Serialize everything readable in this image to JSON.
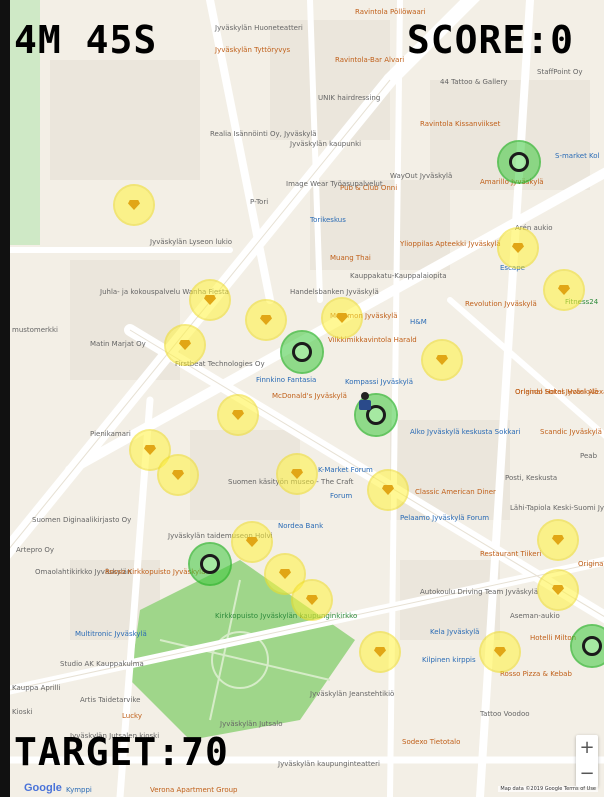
{
  "hud": {
    "timer": "4M 45S",
    "score": "SCORE:0",
    "target": "TARGET:70"
  },
  "map": {
    "attribution": "Map data ©2019 Google   Terms of Use",
    "google_badge": "Google",
    "zoom_in": "+",
    "zoom_out": "−",
    "place_labels": [
      {
        "text": "Jyväskylän Huoneteatteri",
        "style": "grey"
      },
      {
        "text": "Jyväskylän Tyttöryvys",
        "style": "orange"
      },
      {
        "text": "Ravintola Pöllöwaari",
        "style": "orange"
      },
      {
        "text": "Ravintola-Bar Alvari",
        "style": "orange"
      },
      {
        "text": "44 Tattoo & Gallery",
        "style": "grey"
      },
      {
        "text": "StaffPoint Oy",
        "style": "grey"
      },
      {
        "text": "UNIK hairdressing",
        "style": "grey"
      },
      {
        "text": "Ravintola Kissanviikset",
        "style": "orange"
      },
      {
        "text": "Jyväskylän kaupunki",
        "style": "grey"
      },
      {
        "text": "Realia Isännöinti Oy, Jyväskylä",
        "style": "grey"
      },
      {
        "text": "S-market Kol",
        "style": "blue"
      },
      {
        "text": "WayOut Jyväskylä",
        "style": "grey"
      },
      {
        "text": "Amarillo Jyväskylä",
        "style": "orange"
      },
      {
        "text": "Pub & Club Onni",
        "style": "orange"
      },
      {
        "text": "Image Wear Työasupalvelut",
        "style": "grey"
      },
      {
        "text": "P-Tori",
        "style": "grey"
      },
      {
        "text": "Torikeskus",
        "style": "blue"
      },
      {
        "text": "Arén aukio",
        "style": "grey"
      },
      {
        "text": "Ylioppilas Apteekki Jyväskylä",
        "style": "orange"
      },
      {
        "text": "Jyväskylän Lyseon lukio",
        "style": "grey"
      },
      {
        "text": "Muang Thai",
        "style": "orange"
      },
      {
        "text": "Escape",
        "style": "blue"
      },
      {
        "text": "Kauppakatu-Kauppalaiopita",
        "style": "grey"
      },
      {
        "text": "Handelsbanken Jyväskylä",
        "style": "grey"
      },
      {
        "text": "Fitness24",
        "style": "green"
      },
      {
        "text": "Juhla- ja kokouspalvelu Wanha Fiesta",
        "style": "grey"
      },
      {
        "text": "H&M",
        "style": "blue"
      },
      {
        "text": "Revolution Jyväskylä",
        "style": "orange"
      },
      {
        "text": "Mummon Jyväskylä",
        "style": "orange"
      },
      {
        "text": "Vilkkimikkavintola Harald",
        "style": "orange"
      },
      {
        "text": "mustomerkki",
        "style": "grey"
      },
      {
        "text": "Matin Marjat Oy",
        "style": "grey"
      },
      {
        "text": "Firstbeat Technologies Oy",
        "style": "grey"
      },
      {
        "text": "Finnkino Fantasia",
        "style": "blue"
      },
      {
        "text": "Kompassi Jyväskylä",
        "style": "blue"
      },
      {
        "text": "McDonald's Jyväskylä",
        "style": "orange"
      },
      {
        "text": "Original Sokos Hotel Alexandra",
        "style": "orange"
      },
      {
        "text": "Pienikamari",
        "style": "grey"
      },
      {
        "text": "Alko Jyväskylä keskusta Sokkari",
        "style": "blue"
      },
      {
        "text": "Scandic Jyväskylä",
        "style": "orange"
      },
      {
        "text": "K-Market Forum",
        "style": "blue"
      },
      {
        "text": "Posti, Keskusta",
        "style": "grey"
      },
      {
        "text": "Suomen käsityön museo - The Craft",
        "style": "grey"
      },
      {
        "text": "Forum",
        "style": "blue"
      },
      {
        "text": "Classic American Diner",
        "style": "orange"
      },
      {
        "text": "Lähi-Tapiola Keski-Suomi Jyväskylä",
        "style": "grey"
      },
      {
        "text": "Suomen Diginaalikirjasto Oy",
        "style": "grey"
      },
      {
        "text": "Nordea Bank",
        "style": "blue"
      },
      {
        "text": "Pelaamo Jyväskylä Forum",
        "style": "blue"
      },
      {
        "text": "Jyväskylän taidemuseon Holvi",
        "style": "grey"
      },
      {
        "text": "Restaurant Tiikeri",
        "style": "orange"
      },
      {
        "text": "Artepro Oy",
        "style": "grey"
      },
      {
        "text": "Omaolahtikirkko Jyväskylän",
        "style": "grey"
      },
      {
        "text": "Rosso Kirkkopuisto Jyväskylä",
        "style": "orange"
      },
      {
        "text": "Autokoulu Driving Team Jyväskylä",
        "style": "grey"
      },
      {
        "text": "Aseman-aukio",
        "style": "grey"
      },
      {
        "text": "Kirkkopuisto Jyväskylän kaupunginkirkko",
        "style": "green"
      },
      {
        "text": "Multitronic Jyväskylä",
        "style": "blue"
      },
      {
        "text": "Kela Jyväskylä",
        "style": "blue"
      },
      {
        "text": "Hotelli Milton",
        "style": "orange"
      },
      {
        "text": "Studio AK Kauppakulma",
        "style": "grey"
      },
      {
        "text": "Kilpinen kirppis",
        "style": "blue"
      },
      {
        "text": "Rosso Pizza & Kebab",
        "style": "orange"
      },
      {
        "text": "Kauppa Aprilli",
        "style": "grey"
      },
      {
        "text": "Artis Taidetarvike",
        "style": "grey"
      },
      {
        "text": "Jyväskylän Jeanstehtikiö",
        "style": "grey"
      },
      {
        "text": "Lucky",
        "style": "orange"
      },
      {
        "text": "Tattoo Voodoo",
        "style": "grey"
      },
      {
        "text": "Kioski",
        "style": "grey"
      },
      {
        "text": "Jyväskylän Jutsalo",
        "style": "grey"
      },
      {
        "text": "Jyväskylän Jutsalen kioski",
        "style": "grey"
      },
      {
        "text": "Sodexo Tietotalo",
        "style": "orange"
      },
      {
        "text": "Jyväskylän kaupunginteatteri",
        "style": "grey"
      },
      {
        "text": "Kymppi",
        "style": "blue"
      },
      {
        "text": "Verona Apartment Group",
        "style": "orange"
      },
      {
        "text": "Peab",
        "style": "grey"
      },
      {
        "text": "Orlando Hotel Jyväskylä",
        "style": "orange"
      },
      {
        "text": "Original Hotel",
        "style": "orange"
      }
    ]
  },
  "colors": {
    "gem_fill": "#fff23c",
    "checkpoint_fill": "#3cc83c",
    "park": "#9fd68a",
    "map_bg": "#f3efe6",
    "road": "#ffffff"
  },
  "collectibles": {
    "gems": 27,
    "checkpoints": 5
  }
}
